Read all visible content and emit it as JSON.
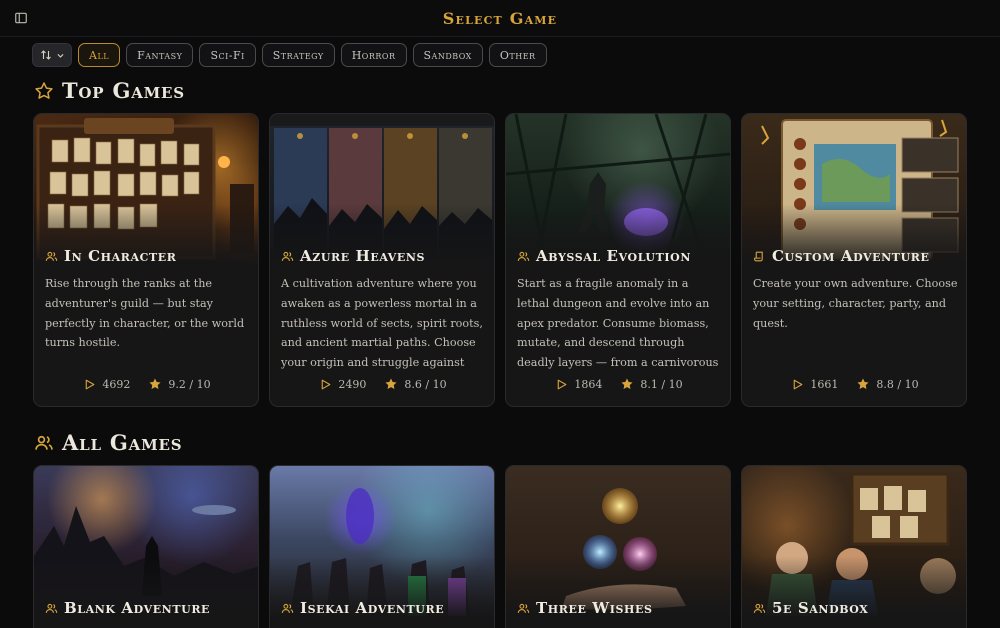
{
  "header": {
    "title": "Select Game"
  },
  "filters": {
    "sort_icon": "sort-arrows-icon",
    "chips": [
      "All",
      "Fantasy",
      "Sci-Fi",
      "Strategy",
      "Horror",
      "Sandbox",
      "Other"
    ],
    "active": "All"
  },
  "top_games": {
    "heading": "Top Games",
    "icon": "star-outline-icon",
    "cards": [
      {
        "title": "In Character",
        "icon": "users-icon",
        "description": "Rise through the ranks at the adventurer's guild — but stay perfectly in character, or the world turns hostile.",
        "plays": "4692",
        "rating": "9.2 / 10"
      },
      {
        "title": "Azure Heavens",
        "icon": "users-icon",
        "description": "A cultivation adventure where you awaken as a powerless mortal in a ruthless world of sects, spirit roots, and ancient martial paths. Choose your origin and struggle against fate on the…",
        "plays": "2490",
        "rating": "8.6 / 10"
      },
      {
        "title": "Abyssal Evolution",
        "icon": "users-icon",
        "description": "Start as a fragile anomaly in a lethal dungeon and evolve into an apex predator. Consume biomass, mutate, and descend through deadly layers — from a carnivorous greenhouse to…",
        "plays": "1864",
        "rating": "8.1 / 10"
      },
      {
        "title": "Custom Adventure",
        "icon": "scroll-icon",
        "description": "Create your own adventure. Choose your setting, character, party, and quest.",
        "plays": "1661",
        "rating": "8.8 / 10"
      }
    ]
  },
  "all_games": {
    "heading": "All Games",
    "icon": "users-icon",
    "cards": [
      {
        "title": "Blank Adventure",
        "icon": "users-icon"
      },
      {
        "title": "Isekai Adventure",
        "icon": "users-icon"
      },
      {
        "title": "Three Wishes",
        "icon": "users-icon"
      },
      {
        "title": "5e Sandbox",
        "icon": "users-icon"
      }
    ]
  },
  "colors": {
    "accent": "#d8a53a",
    "background": "#0b0b0c",
    "card": "#161617"
  }
}
